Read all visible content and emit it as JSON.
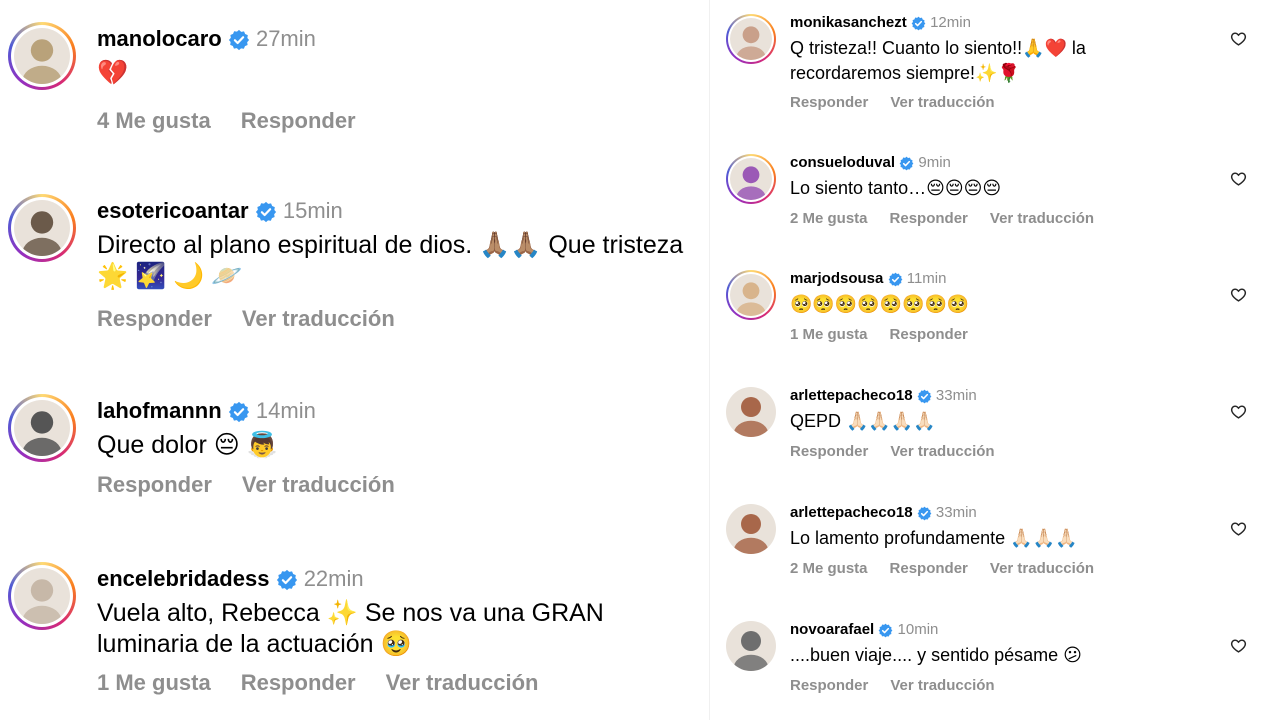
{
  "left_comments": [
    {
      "username": "manolocaro",
      "time": "27min",
      "text": "💔",
      "actions": [
        "4 Me gusta",
        "Responder"
      ],
      "avatar_color": "#b9a27a",
      "ring": true
    },
    {
      "username": "esotericoantar",
      "time": "15min",
      "text": "Directo al plano espiritual de dios. 🙏🏽🙏🏽 Que tristeza 🌟 🌠 🌙 🪐",
      "actions": [
        "Responder",
        "Ver traducción"
      ],
      "avatar_color": "#6b5a4a",
      "ring": true
    },
    {
      "username": "lahofmannn",
      "time": "14min",
      "text": "Que dolor 😔 👼",
      "actions": [
        "Responder",
        "Ver traducción"
      ],
      "avatar_color": "#555555",
      "ring": true
    },
    {
      "username": "encelebridadess",
      "time": "22min",
      "text": "Vuela alto, Rebecca ✨ Se nos va una GRAN luminaria de la actuación 🥹",
      "actions": [
        "1 Me gusta",
        "Responder",
        "Ver traducción"
      ],
      "avatar_color": "#c7b8a8",
      "ring": true
    }
  ],
  "right_comments": [
    {
      "username": "monikasanchezt",
      "time": "12min",
      "text": "Q tristeza!! Cuanto lo siento!!🙏❤️ la recordaremos siempre!✨🌹",
      "actions": [
        "Responder",
        "Ver traducción"
      ],
      "avatar_color": "#c9a08a",
      "ring": true
    },
    {
      "username": "consueloduval",
      "time": "9min",
      "text": "Lo siento tanto…😔😔😔😔",
      "actions": [
        "2 Me gusta",
        "Responder",
        "Ver traducción"
      ],
      "avatar_color": "#9b59b6",
      "ring": true
    },
    {
      "username": "marjodsousa",
      "time": "11min",
      "text": "🥺🥺🥺🥺🥺🥺🥺🥺",
      "actions": [
        "1 Me gusta",
        "Responder"
      ],
      "avatar_color": "#d8b48c",
      "ring": true
    },
    {
      "username": "arlettepacheco18",
      "time": "33min",
      "text": "QEPD 🙏🏻🙏🏻🙏🏻🙏🏻",
      "actions": [
        "Responder",
        "Ver traducción"
      ],
      "avatar_color": "#a8674a",
      "ring": false
    },
    {
      "username": "arlettepacheco18",
      "time": "33min",
      "text": "Lo lamento profundamente 🙏🏻🙏🏻🙏🏻",
      "actions": [
        "2 Me gusta",
        "Responder",
        "Ver traducción"
      ],
      "avatar_color": "#a8674a",
      "ring": false
    },
    {
      "username": "novoarafael",
      "time": "10min",
      "text": "....buen viaje.... y sentido pésame 😕",
      "actions": [
        "Responder",
        "Ver traducción"
      ],
      "avatar_color": "#6e6e6e",
      "ring": false
    }
  ],
  "colors": {
    "verified": "#3897f0",
    "muted": "#8e8e8e"
  },
  "icons": {
    "verified": "verified-badge-icon",
    "heart": "heart-outline-icon"
  }
}
